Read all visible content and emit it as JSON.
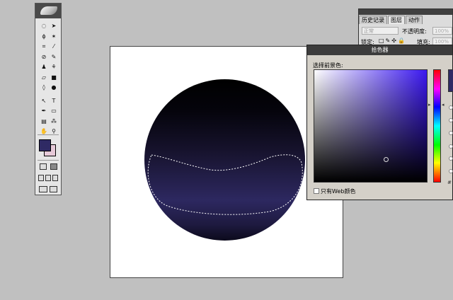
{
  "toolbox": {
    "fg_color": "#2f2a64",
    "bg_color": "#e6c9d8",
    "tools": [
      {
        "name": "marquee-tool",
        "glyph": "◌"
      },
      {
        "name": "move-tool",
        "glyph": "➤"
      },
      {
        "name": "lasso-tool",
        "glyph": "ϕ"
      },
      {
        "name": "magic-wand-tool",
        "glyph": "✶"
      },
      {
        "name": "crop-tool",
        "glyph": "⌗"
      },
      {
        "name": "slice-tool",
        "glyph": "⁄"
      },
      {
        "name": "healing-brush-tool",
        "glyph": "⊘"
      },
      {
        "name": "brush-tool",
        "glyph": "✎"
      },
      {
        "name": "stamp-tool",
        "glyph": "♟"
      },
      {
        "name": "history-brush-tool",
        "glyph": "⚘"
      },
      {
        "name": "eraser-tool",
        "glyph": "▱"
      },
      {
        "name": "gradient-tool",
        "glyph": "■"
      },
      {
        "name": "blur-tool",
        "glyph": "◊"
      },
      {
        "name": "dodge-tool",
        "glyph": "●"
      },
      {
        "name": "path-selection-tool",
        "glyph": "↖"
      },
      {
        "name": "type-tool",
        "glyph": "T"
      },
      {
        "name": "pen-tool",
        "glyph": "✒"
      },
      {
        "name": "shape-tool",
        "glyph": "▭"
      },
      {
        "name": "notes-tool",
        "glyph": "▤"
      },
      {
        "name": "eyedropper-tool",
        "glyph": "⁂"
      },
      {
        "name": "hand-tool",
        "glyph": "✋"
      },
      {
        "name": "zoom-tool",
        "glyph": "⚲"
      }
    ]
  },
  "layers_panel": {
    "tabs": [
      {
        "label": "历史记录"
      },
      {
        "label": "图层"
      },
      {
        "label": "动作"
      }
    ],
    "blend_mode": "正常",
    "opacity_label": "不透明度:",
    "opacity_value": "100%",
    "lock_label": "锁定:",
    "fill_label": "填充:",
    "fill_value": "100%"
  },
  "color_picker": {
    "title": "拾色器",
    "prompt": "选择前景色:",
    "web_only_label": "只有Web颜色",
    "hash": "#",
    "current_color": "#2f2a64",
    "hue_color": "#3b18f0"
  }
}
